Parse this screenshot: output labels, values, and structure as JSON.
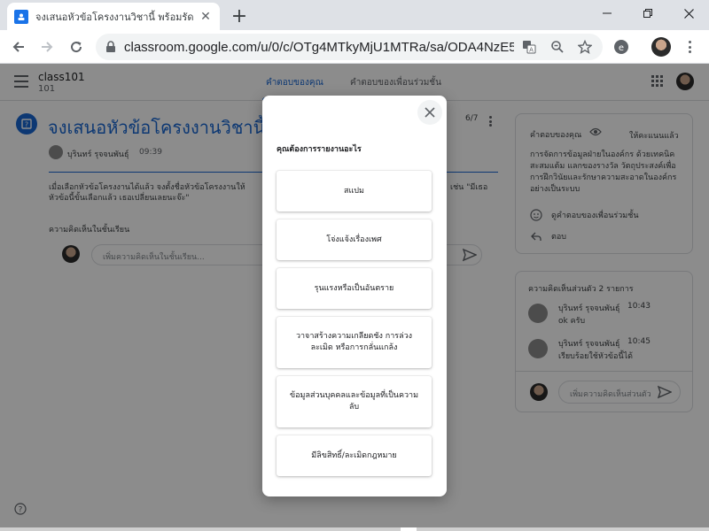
{
  "browser": {
    "tab_title": "จงเสนอหัวข้อโครงงานวิชานี้ พร้อมรัดกุม",
    "url": "classroom.google.com/u/0/c/OTg4MTkyMjU1MTRa/sa/ODA4NzE5O..."
  },
  "app": {
    "class_name": "class101",
    "class_section": "101",
    "tabs": [
      {
        "label": "คำตอบของคุณ",
        "active": true
      },
      {
        "label": "คำตอบของเพื่อนร่วมชั้น",
        "active": false
      }
    ]
  },
  "assignment": {
    "title": "จงเสนอหัวข้อโครงงานวิชานี้",
    "page_count": "6/7",
    "author": "บุรินทร์ รุจจนพันธุ์",
    "time": "09:39",
    "description": "เมื่อเลือกหัวข้อโครงงานได้แล้ว จงตั้งชื่อหัวข้อโครงงานให้",
    "description_line2": "หัวข้อนี้ขั้นเลือกแล้ว เธอเปลี่ยนเลยนะจ๊ะ\"",
    "description_right": "เช่น \"มีเธอ",
    "class_comments_label": "ความคิดเห็นในชั้นเรียน",
    "comment_placeholder": "เพิ่มความคิดเห็นในชั้นเรียน..."
  },
  "your_work": {
    "title": "คำตอบของคุณ",
    "status": "ให้คะแนนแล้ว",
    "text": "การจัดการข้อมูลฝ่ายในองค์กร ด้วยเทคนิคสะสมแต้ม แลกของรางวัล วัตถุประสงค์เพื่อการฝึกวินัยและรักษาความสะอาดในองค์กรอย่างเป็นระบบ",
    "view_classmates": "ดูคำตอบของเพื่อนร่วมชั้น",
    "reply": "ตอบ"
  },
  "private_comments": {
    "title": "ความคิดเห็นส่วนตัว 2 รายการ",
    "items": [
      {
        "name": "บุรินทร์ รุจจนพันธุ์",
        "time": "10:43",
        "message": "ok ครับ"
      },
      {
        "name": "บุรินทร์ รุจจนพันธุ์",
        "time": "10:45",
        "message": "เรียบร้อยใช้หัวข้อนี้ได้"
      }
    ],
    "placeholder": "เพิ่มความคิดเห็นส่วนตัว"
  },
  "report_dialog": {
    "title": "คุณต้องการรายงานอะไร",
    "options": [
      "สแปม",
      "โจ่งแจ้งเรื่องเพศ",
      "รุนแรงหรือเป็นอันตราย",
      "วาจาสร้างความเกลียดชัง การล่วงละเมิด หรือการกลั่นแกล้ง",
      "ข้อมูลส่วนบุคคลและข้อมูลที่เป็นความลับ",
      "มีลิขสิทธิ์/ละเมิดกฎหมาย"
    ]
  },
  "colors": {
    "accent": "#1967d2",
    "favicon": "#1a73e8"
  }
}
